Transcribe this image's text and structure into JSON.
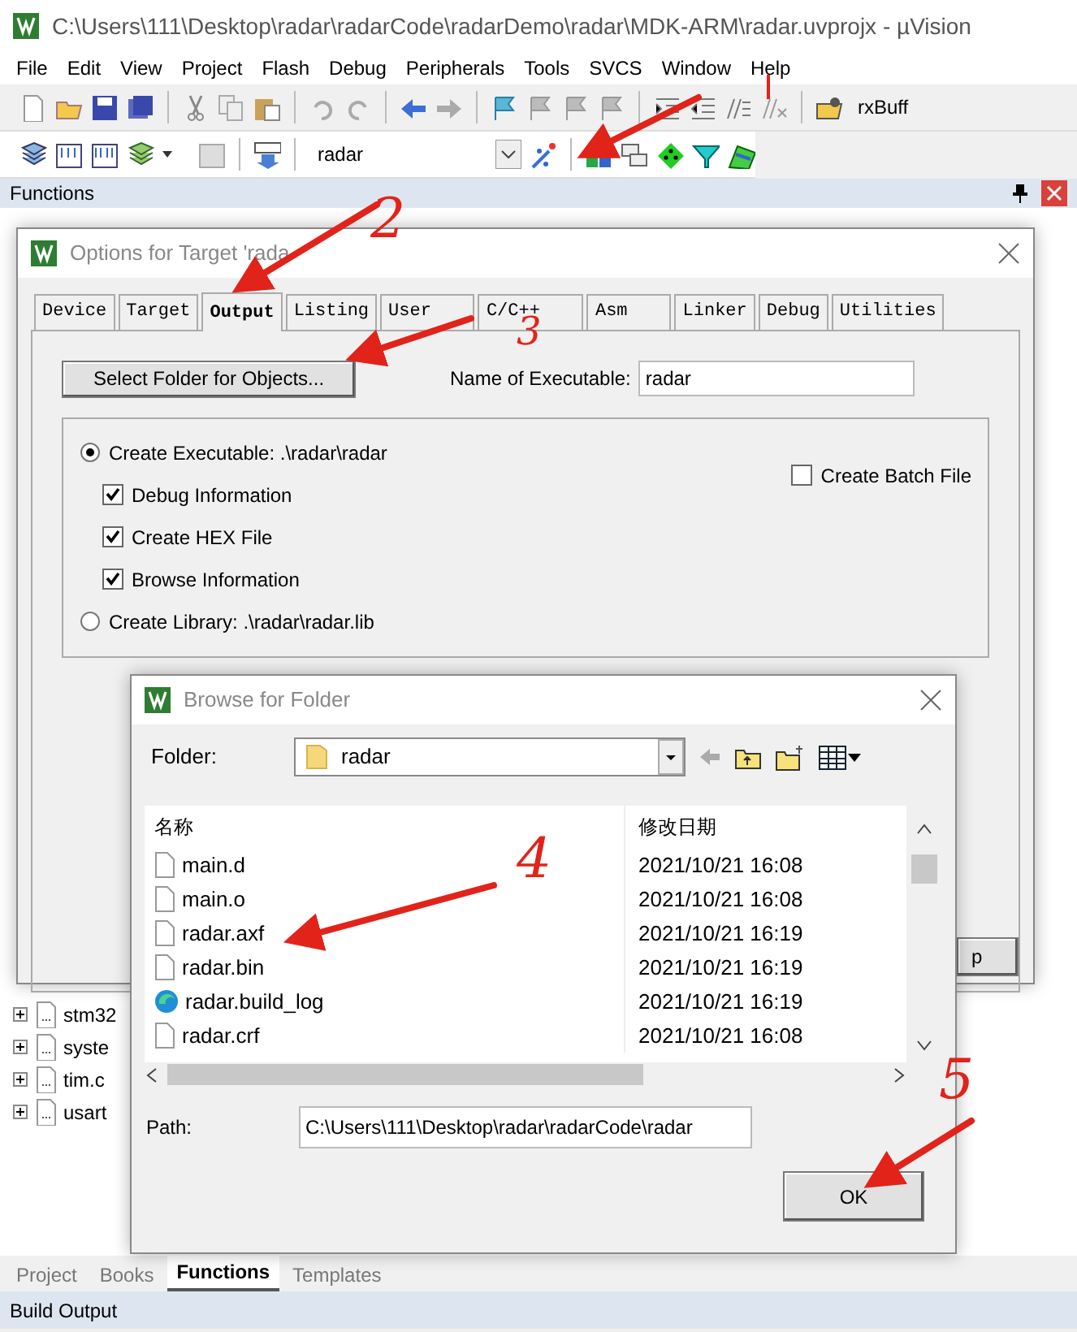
{
  "window": {
    "title": "C:\\Users\\111\\Desktop\\radar\\radarCode\\radarDemo\\radar\\MDK-ARM\\radar.uvprojx - µVision"
  },
  "menu": [
    "File",
    "Edit",
    "View",
    "Project",
    "Flash",
    "Debug",
    "Peripherals",
    "Tools",
    "SVCS",
    "Window",
    "Help"
  ],
  "toolbar": {
    "watch_field": "rxBuff",
    "target": "radar"
  },
  "functions_panel": {
    "title": "Functions",
    "tree": [
      {
        "label": "stm32"
      },
      {
        "label": "syste"
      },
      {
        "label": "tim.c"
      },
      {
        "label": "usart"
      }
    ]
  },
  "bottom_tabs": [
    {
      "label": "Project",
      "selected": false
    },
    {
      "label": "Books",
      "selected": false
    },
    {
      "label": "Functions",
      "selected": true
    },
    {
      "label": "Templates",
      "selected": false
    }
  ],
  "status_bar": "Build Output",
  "options_dialog": {
    "title": "Options for Target 'rada",
    "tabs": [
      {
        "label": "Device",
        "selected": false
      },
      {
        "label": "Target",
        "selected": false
      },
      {
        "label": "Output",
        "selected": true
      },
      {
        "label": "Listing",
        "selected": false
      },
      {
        "label": "User",
        "selected": false
      },
      {
        "label": "C/C++",
        "selected": false
      },
      {
        "label": "Asm",
        "selected": false
      },
      {
        "label": "Linker",
        "selected": false
      },
      {
        "label": "Debug",
        "selected": false
      },
      {
        "label": "Utilities",
        "selected": false
      }
    ],
    "select_folder_button": "Select Folder for Objects...",
    "name_label": "Name of Executable:",
    "name_value": "radar",
    "options": [
      {
        "kind": "radio",
        "label": "Create Executable:  .\\radar\\radar",
        "checked": true
      },
      {
        "kind": "checkbox",
        "label": "Debug Information",
        "checked": true
      },
      {
        "kind": "checkbox",
        "label": "Create HEX File",
        "checked": true
      },
      {
        "kind": "checkbox",
        "label": "Browse Information",
        "checked": true
      },
      {
        "kind": "radio",
        "label": "Create Library:  .\\radar\\radar.lib",
        "checked": false
      }
    ],
    "batch_file": {
      "label": "Create Batch File",
      "checked": false
    },
    "partial_button": "p"
  },
  "browse_dialog": {
    "title": "Browse for Folder",
    "folder_label": "Folder:",
    "folder_value": "radar",
    "columns": [
      "名称",
      "修改日期"
    ],
    "rows": [
      {
        "name": "main.d",
        "date": "2021/10/21 16:08",
        "kind": "file"
      },
      {
        "name": "main.o",
        "date": "2021/10/21 16:08",
        "kind": "file"
      },
      {
        "name": "radar.axf",
        "date": "2021/10/21 16:19",
        "kind": "file"
      },
      {
        "name": "radar.bin",
        "date": "2021/10/21 16:19",
        "kind": "file"
      },
      {
        "name": "radar.build_log",
        "date": "2021/10/21 16:19",
        "kind": "browser"
      },
      {
        "name": "radar.crf",
        "date": "2021/10/21 16:08",
        "kind": "file"
      }
    ],
    "path_label": "Path:",
    "path_value": "C:\\Users\\111\\Desktop\\radar\\radarCode\\radar",
    "ok_button": "OK"
  },
  "annotations": [
    {
      "label": "2"
    },
    {
      "label": "3"
    },
    {
      "label": "4"
    },
    {
      "label": "5"
    }
  ]
}
